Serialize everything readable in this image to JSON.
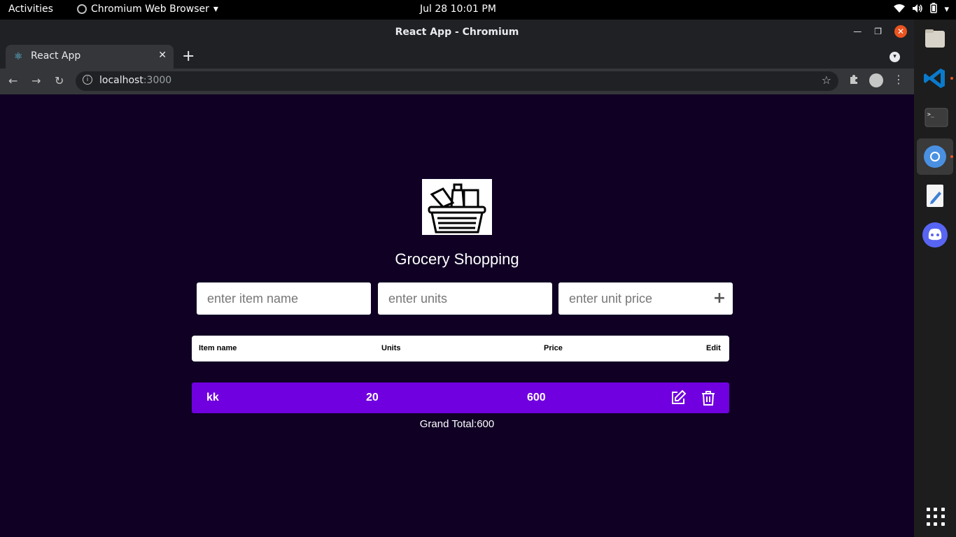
{
  "system_bar": {
    "activities": "Activities",
    "app_name": "Chromium Web Browser",
    "clock": "Jul 28  10:01 PM"
  },
  "window": {
    "title": "React App - Chromium"
  },
  "tabs": [
    {
      "label": "React App",
      "active": true
    }
  ],
  "address_bar": {
    "host": "localhost",
    "port": ":3000"
  },
  "app": {
    "title": "Grocery Shopping",
    "inputs": {
      "item_placeholder": "enter item name",
      "units_placeholder": "enter units",
      "price_placeholder": "enter unit price"
    },
    "add_symbol": "+",
    "table": {
      "headers": [
        "Item name",
        "Units",
        "Price",
        "Edit"
      ],
      "rows": [
        {
          "name": "kk",
          "units": "20",
          "price": "600"
        }
      ]
    },
    "grand_total": "Grand Total:600"
  },
  "dock": {
    "apps": [
      "files-icon",
      "vscode-icon",
      "terminal-icon",
      "chromium-icon",
      "text-editor-icon",
      "discord-icon"
    ]
  },
  "colors": {
    "page_bg": "#0f0024",
    "row_bg": "#7000df",
    "accent_close": "#e95420"
  }
}
